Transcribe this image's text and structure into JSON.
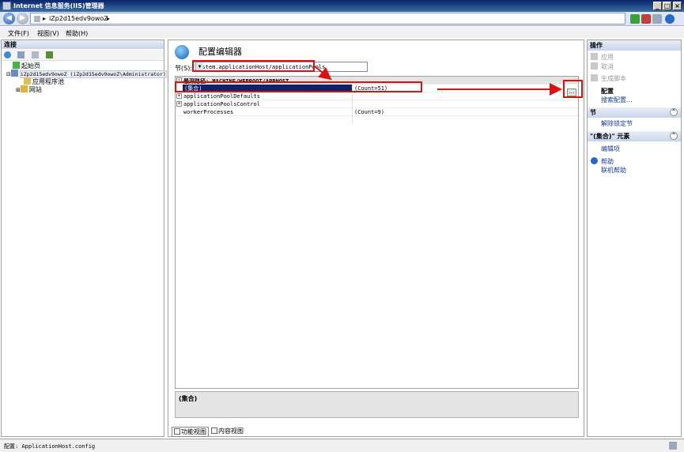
{
  "window": {
    "title": "Internet 信息服务(IIS)管理器",
    "min": "_",
    "max": "□",
    "close": "×"
  },
  "address": {
    "sep1": "▸",
    "server": "iZp2d15edv9owoZ",
    "sep2": "▸"
  },
  "menu": [
    "文件(F)",
    "视图(V)",
    "帮助(H)"
  ],
  "connections": {
    "header": "连接",
    "nodes": [
      {
        "label": "起始页"
      },
      {
        "label": "iZp2d15edv9owoZ (iZp2d15edv9owoZ\\Administrator)"
      },
      {
        "label": "应用程序池"
      },
      {
        "label": "网站"
      }
    ]
  },
  "center": {
    "title": "配置编辑器",
    "section_label": "节(S):",
    "section_value": "system.applicationHost/applicationPools",
    "path_label": "最深路径: MACHINE/WEBROOT/APPHOST",
    "rows": [
      {
        "key": "(集合)",
        "value": "(Count=51)"
      },
      {
        "key": "applicationPoolDefaults",
        "value": ""
      },
      {
        "key": "applicationPoolsControl",
        "value": ""
      },
      {
        "key": "workerProcesses",
        "value": "(Count=9)"
      }
    ],
    "ellipsis": "...",
    "description": "(集合)",
    "tab_feature": "功能视图",
    "tab_content": "内容视图"
  },
  "actions": {
    "header": "操作",
    "apply": "应用",
    "cancel": "取消",
    "gen_script": "生成脚本",
    "config_title": "配置",
    "search_config": "搜索配置...",
    "section_header": "节",
    "unlock": "解除锁定节",
    "collection_header": "\"(集合)\" 元素",
    "edit_items": "编辑项",
    "help": "帮助",
    "online_help": "联机帮助"
  },
  "status": "配置: ApplicationHost.config",
  "colors": {
    "selection": "#0a246a",
    "annotation": "#e01010"
  }
}
